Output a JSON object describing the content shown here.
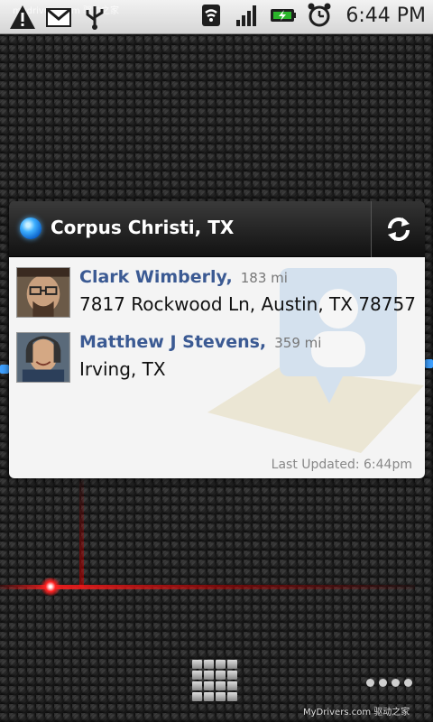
{
  "status_bar": {
    "time": "6:44 PM",
    "watermark": "mydrivers.com 驱动之家",
    "icons_left": [
      "warning-icon",
      "gmail-icon",
      "usb-icon"
    ],
    "icons_right": [
      "wifi-icon",
      "signal-icon",
      "battery-charging-icon",
      "alarm-icon"
    ]
  },
  "widget": {
    "location": "Corpus Christi, TX",
    "refresh_icon": "refresh-icon",
    "contacts": [
      {
        "name": "Clark Wimberly",
        "separator": ",",
        "distance": "183 mi",
        "address": "7817 Rockwood Ln, Austin, TX 78757"
      },
      {
        "name": "Matthew J Stevens",
        "separator": ",",
        "distance": "359 mi",
        "address": "Irving, TX"
      }
    ],
    "last_updated": "Last Updated: 6:44pm"
  },
  "dock": {
    "launcher_icon": "app-drawer-icon",
    "menu_icon": "more-dots-icon"
  },
  "footer_watermark": "MyDrivers.com 驱动之家",
  "colors": {
    "contact_name": "#3b5a93",
    "widget_header": "#1c1c1c",
    "status_bar": "#e3e3e3",
    "led_trail": "#ff2020"
  }
}
